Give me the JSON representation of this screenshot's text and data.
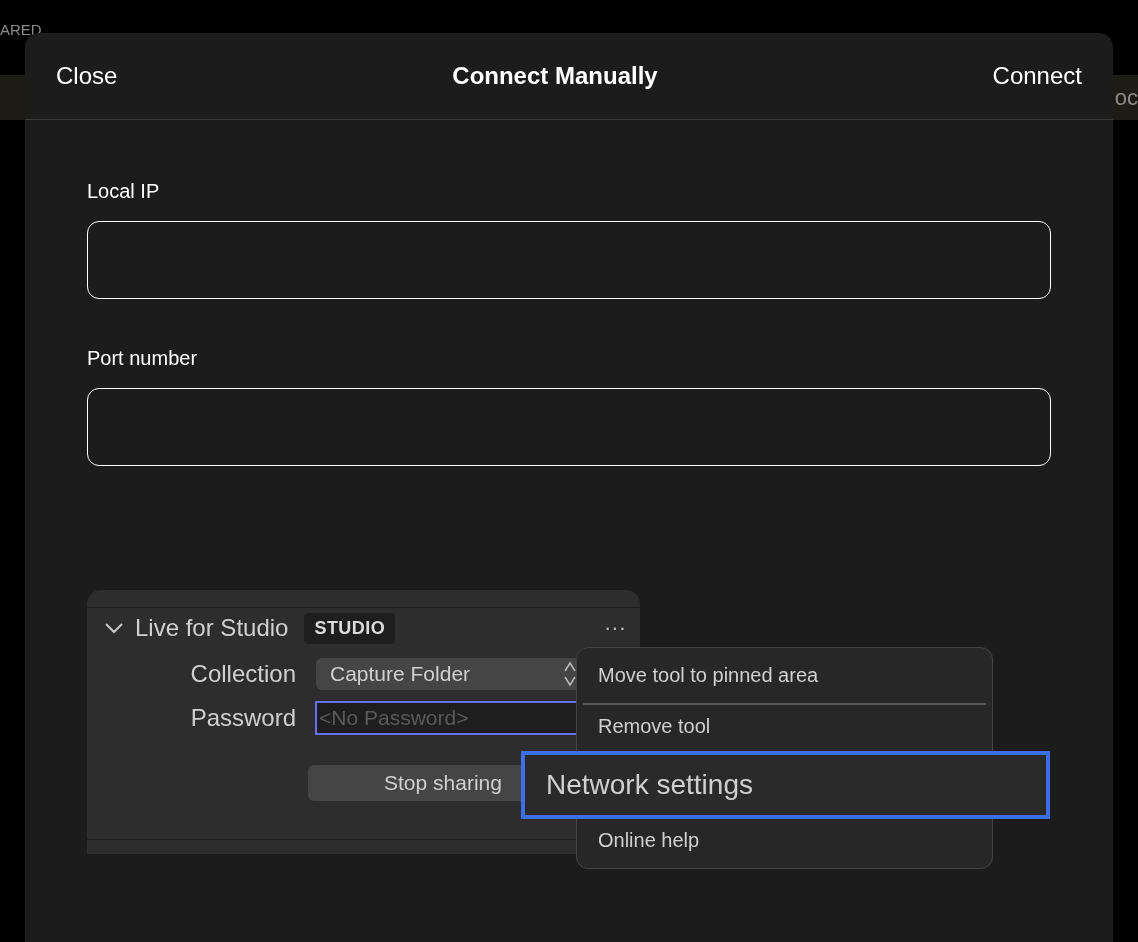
{
  "background": {
    "heading": "ARED",
    "toolbar_right": "oc"
  },
  "dialog": {
    "title": "Connect Manually",
    "close": "Close",
    "confirm": "Connect"
  },
  "fields": [
    {
      "label": "Local IP"
    },
    {
      "label": "Port number"
    }
  ],
  "tool_panel": {
    "title": "Live for Studio",
    "expanded": true,
    "badge": "STUDIO",
    "more": "···",
    "rows": [
      {
        "kind": "select",
        "label": "Collection",
        "value": "Capture Folder"
      },
      {
        "kind": "input",
        "label": "Password",
        "placeholder": "<No Password>"
      }
    ],
    "button": "Stop sharing"
  },
  "menu": [
    {
      "kind": "item",
      "label": "Move tool to pinned area",
      "selected": false
    },
    {
      "kind": "separator"
    },
    {
      "kind": "item",
      "label": "Remove tool",
      "selected": false
    },
    {
      "kind": "item",
      "label": "Network settings",
      "selected": true
    },
    {
      "kind": "item",
      "label": "Online help",
      "selected": false
    }
  ]
}
